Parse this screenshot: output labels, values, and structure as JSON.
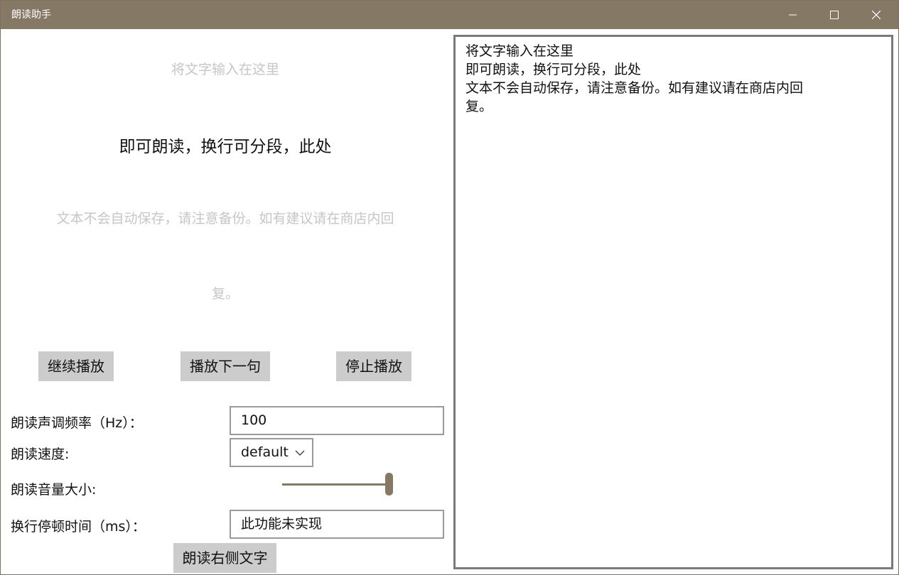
{
  "window": {
    "title": "朗读助手"
  },
  "preview": {
    "lines": [
      "将文字输入在这里",
      "即可朗读，换行可分段，此处",
      "文本不会自动保存，请注意备份。如有建议请在商店内回",
      "复。"
    ],
    "active_index": 1
  },
  "controls": {
    "continue_label": "继续播放",
    "next_label": "播放下一句",
    "stop_label": "停止播放"
  },
  "settings": {
    "pitch_label": "朗读声调频率（Hz）：",
    "pitch_value": "100",
    "speed_label": "朗读速度:",
    "speed_value": "default",
    "volume_label": "朗读音量大小:",
    "volume_level": 1.0,
    "pause_label": "换行停顿时间（ms）：",
    "pause_value": "此功能未实现",
    "read_right_label": "朗读右侧文字"
  },
  "editor": {
    "lines": [
      "将文字输入在这里",
      "即可朗读，换行可分段，此处",
      "文本不会自动保存，请注意备份。如有建议请在商店内回",
      "复。"
    ]
  },
  "colors": {
    "titlebar": "#857865",
    "accent": "#857865",
    "button": "#cccccc",
    "dim_text": "#c6c6c6"
  },
  "icons": {
    "minimize": "minimize-icon",
    "maximize": "maximize-icon",
    "close": "close-icon",
    "dropdown": "chevron-down-icon"
  }
}
